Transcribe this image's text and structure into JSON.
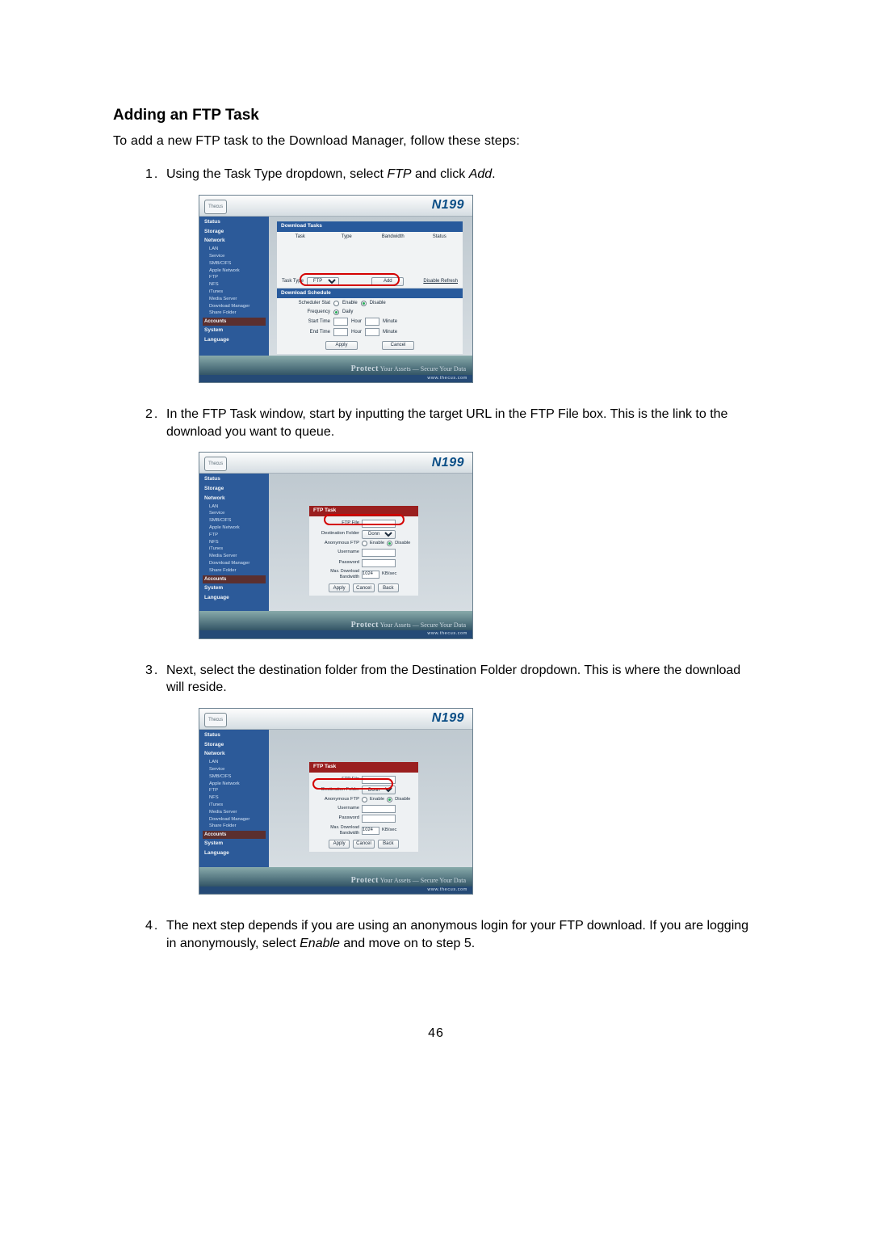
{
  "heading": "Adding an FTP Task",
  "intro": "To add a new FTP task to the Download Manager, follow these steps:",
  "steps": [
    {
      "text_before_em1": "Using the Task Type dropdown, select ",
      "em1": "FTP",
      "text_mid": " and click ",
      "em2": "Add",
      "text_after": "."
    },
    {
      "text": "In the FTP Task window, start by inputting the target URL in the FTP File box. This is the link to the download you want to queue."
    },
    {
      "text": "Next, select the destination folder from the Destination Folder dropdown. This is where the download will reside."
    },
    {
      "text_before_em": "The next step depends if you are using an anonymous login for your FTP download. If you are logging in anonymously, select ",
      "em": "Enable",
      "text_after_em": " and move on to step 5."
    }
  ],
  "fig_common": {
    "logo": "Thecus",
    "brand": "N199",
    "nav_sections": [
      "Status",
      "Storage",
      "Network"
    ],
    "nav_subs": [
      "LAN",
      "Service",
      "SMB/CIFS",
      "Apple Network",
      "FTP",
      "NFS",
      "iTunes",
      "Media Server",
      "Download Manager",
      "Share Folder"
    ],
    "nav_tail": [
      "Accounts",
      "System",
      "Language"
    ],
    "protect": "Protect",
    "protect_tag": "Your Assets — Secure Your Data",
    "urlbar": "www.thecus.com"
  },
  "fig1": {
    "panel_title": "Download Tasks",
    "cols": [
      "Task",
      "Type",
      "Bandwidth",
      "Status"
    ],
    "task_type_label": "Task Type",
    "task_type_value": "FTP",
    "add_btn": "Add",
    "disable_refresh": "Disable Refresh",
    "sched_title": "Download Schedule",
    "scheduler_label": "Scheduler Stat",
    "enable": "Enable",
    "disable": "Disable",
    "frequency_label": "Frequency",
    "daily": "Daily",
    "start_label": "Start Time",
    "end_label": "End Time",
    "hour": "Hour",
    "minute": "Minute",
    "apply": "Apply",
    "cancel": "Cancel"
  },
  "fig_dlg": {
    "title": "FTP Task",
    "ftp_file": "FTP File",
    "dest": "Destination Folder",
    "dest_val": "Donna",
    "anon": "Anonymous FTP",
    "enable": "Enable",
    "disable": "Disable",
    "user": "Username",
    "pass": "Password",
    "bw": "Max. Download Bandwidth",
    "bw_val": "1024",
    "bw_unit": "KB/sec",
    "apply": "Apply",
    "cancel": "Cancel",
    "back": "Back"
  },
  "page_number": "46"
}
